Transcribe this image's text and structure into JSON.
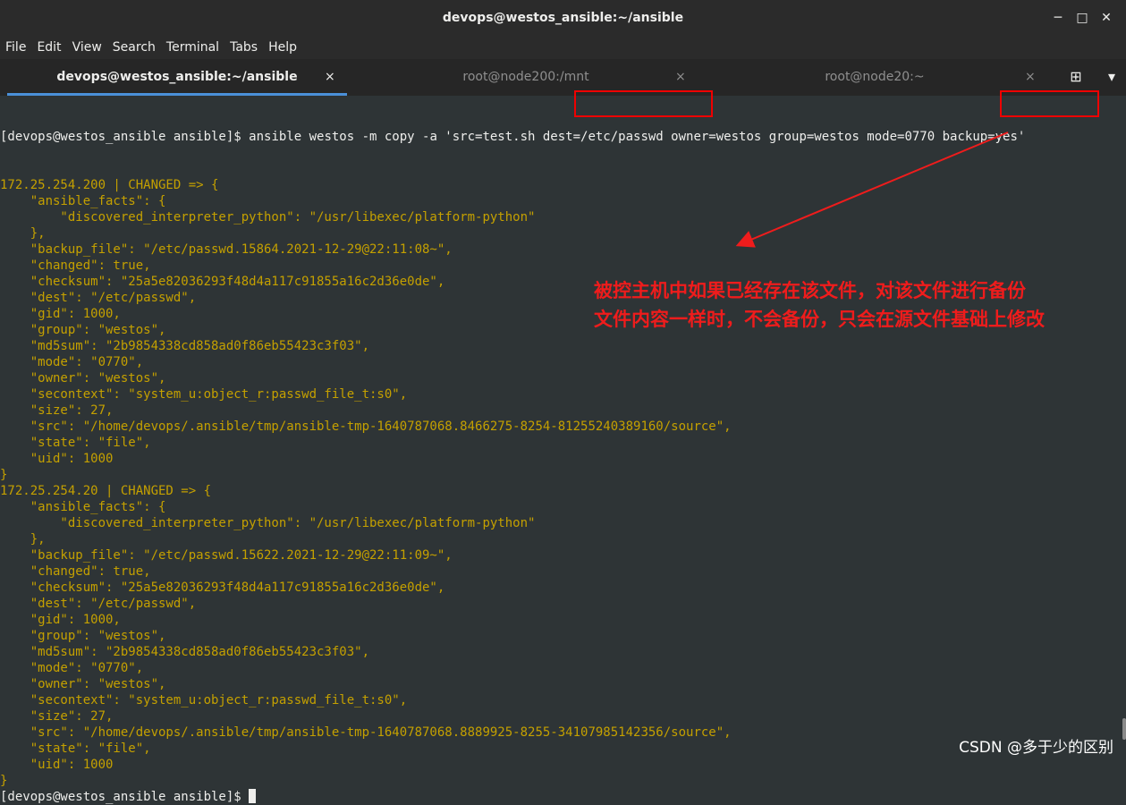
{
  "window": {
    "title": "devops@westos_ansible:~/ansible",
    "minimize": "─",
    "maximize": "□",
    "close": "✕"
  },
  "menu": [
    "File",
    "Edit",
    "View",
    "Search",
    "Terminal",
    "Tabs",
    "Help"
  ],
  "tabs": [
    {
      "label": "devops@westos_ansible:~/ansible",
      "active": true
    },
    {
      "label": "root@node200:/mnt",
      "active": false
    },
    {
      "label": "root@node20:~",
      "active": false
    }
  ],
  "tab_close_glyph": "×",
  "new_tab_glyph": "⊞",
  "tab_menu_glyph": "▾",
  "terminal": {
    "prompt": "[devops@westos_ansible ansible]$ ",
    "command": "ansible westos -m copy -a 'src=test.sh dest=/etc/passwd owner=westos group=westos mode=0770 backup=yes'",
    "output": [
      "172.25.254.200 | CHANGED => {",
      "    \"ansible_facts\": {",
      "        \"discovered_interpreter_python\": \"/usr/libexec/platform-python\"",
      "    },",
      "    \"backup_file\": \"/etc/passwd.15864.2021-12-29@22:11:08~\",",
      "    \"changed\": true,",
      "    \"checksum\": \"25a5e82036293f48d4a117c91855a16c2d36e0de\",",
      "    \"dest\": \"/etc/passwd\",",
      "    \"gid\": 1000,",
      "    \"group\": \"westos\",",
      "    \"md5sum\": \"2b9854338cd858ad0f86eb55423c3f03\",",
      "    \"mode\": \"0770\",",
      "    \"owner\": \"westos\",",
      "    \"secontext\": \"system_u:object_r:passwd_file_t:s0\",",
      "    \"size\": 27,",
      "    \"src\": \"/home/devops/.ansible/tmp/ansible-tmp-1640787068.8466275-8254-81255240389160/source\",",
      "    \"state\": \"file\",",
      "    \"uid\": 1000",
      "}",
      "172.25.254.20 | CHANGED => {",
      "    \"ansible_facts\": {",
      "        \"discovered_interpreter_python\": \"/usr/libexec/platform-python\"",
      "    },",
      "    \"backup_file\": \"/etc/passwd.15622.2021-12-29@22:11:09~\",",
      "    \"changed\": true,",
      "    \"checksum\": \"25a5e82036293f48d4a117c91855a16c2d36e0de\",",
      "    \"dest\": \"/etc/passwd\",",
      "    \"gid\": 1000,",
      "    \"group\": \"westos\",",
      "    \"md5sum\": \"2b9854338cd858ad0f86eb55423c3f03\",",
      "    \"mode\": \"0770\",",
      "    \"owner\": \"westos\",",
      "    \"secontext\": \"system_u:object_r:passwd_file_t:s0\",",
      "    \"size\": 27,",
      "    \"src\": \"/home/devops/.ansible/tmp/ansible-tmp-1640787068.8889925-8255-34107985142356/source\",",
      "    \"state\": \"file\",",
      "    \"uid\": 1000",
      "}"
    ],
    "final_prompt": "[devops@westos_ansible ansible]$ "
  },
  "annotation": {
    "line1": "被控主机中如果已经存在该文件，对该文件进行备份",
    "line2": "文件内容一样时，不会备份，只会在源文件基础上修改"
  },
  "watermark": "CSDN @多于少的区别",
  "colors": {
    "terminal_bg": "#2e3436",
    "output_text": "#c4a000",
    "prompt_text": "#eeeeec",
    "annotation_red": "#ef1c1c"
  }
}
